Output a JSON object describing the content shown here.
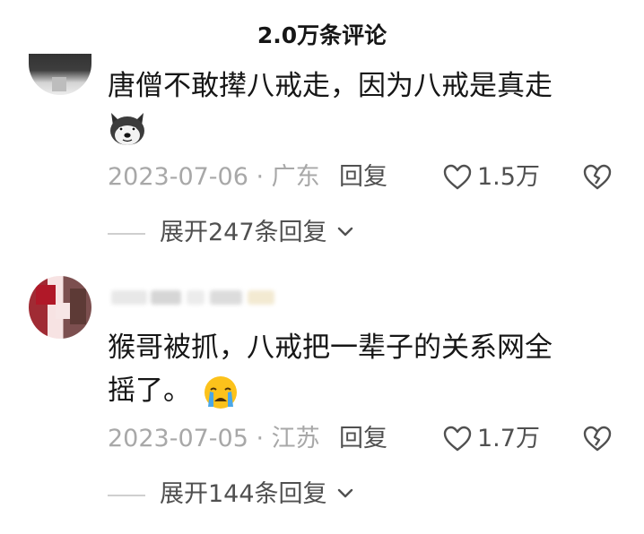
{
  "header": {
    "title": "2.0万条评论"
  },
  "comments": [
    {
      "text_line1": "唐僧不敢撵八戒走，因为八戒是真走",
      "emoji": "husky-emoji-icon",
      "meta": "2023-07-06 · 广东",
      "reply_label": "回复",
      "likes": "1.5万",
      "expand_label": "展开247条回复"
    },
    {
      "text_line1": "猴哥被抓，八戒把一辈子的关系网全",
      "text_line2": "摇了。",
      "emoji": "crying-face-icon",
      "meta": "2023-07-05 · 江苏",
      "reply_label": "回复",
      "likes": "1.7万",
      "expand_label": "展开144条回复"
    }
  ],
  "colors": {
    "primary_text": "#161616",
    "secondary_text": "#a8a8a8",
    "action_text": "#505050",
    "divider": "#cfcfcf"
  }
}
